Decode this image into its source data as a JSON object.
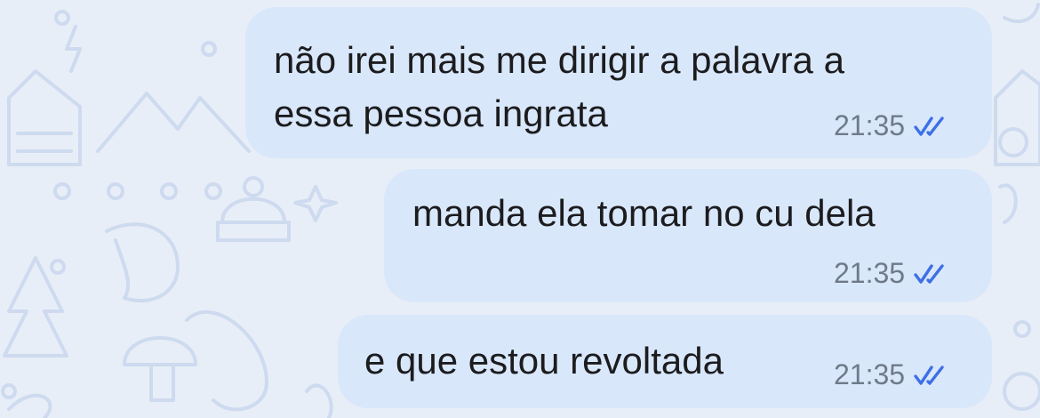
{
  "chat": {
    "messages": [
      {
        "lines": [
          "não irei mais me dirigir a palavra a",
          "essa pessoa ingrata"
        ],
        "time": "21:35",
        "status_icon": "double-check-read-icon"
      },
      {
        "lines": [
          "manda ela tomar no cu dela"
        ],
        "time": "21:35",
        "status_icon": "double-check-read-icon"
      },
      {
        "lines": [
          "e que estou revoltada"
        ],
        "time": "21:35",
        "status_icon": "double-check-read-icon"
      }
    ]
  },
  "colors": {
    "background": "#e8eef7",
    "bubble": "#d9e7fb",
    "text": "#1c1c1e",
    "time": "#6f7a88",
    "check": "#3d6fe6",
    "doodle": "#cddaef"
  }
}
